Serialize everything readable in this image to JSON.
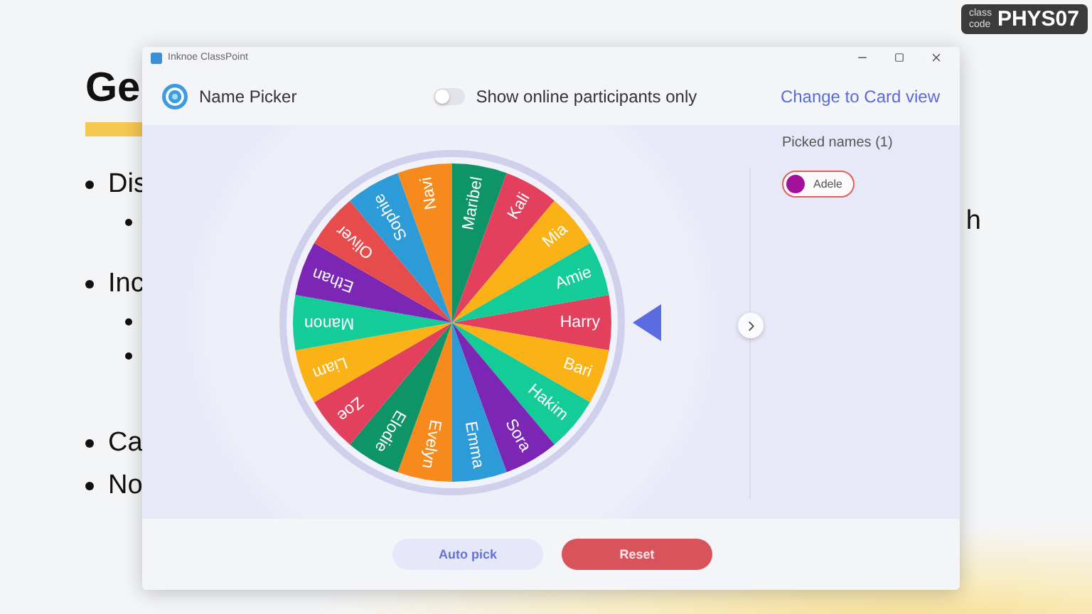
{
  "class_code": {
    "label_top": "class",
    "label_bottom": "code",
    "code": "PHYS07"
  },
  "slide": {
    "title": "Ge",
    "bullets": [
      {
        "text": "Dis",
        "children": [
          {
            "kind": "covered",
            "tail": "h"
          }
        ]
      },
      {
        "text": "Inc",
        "children": [
          {
            "kind": "covered"
          },
          {
            "kind": "covered"
          }
        ]
      },
      {
        "text": "Ca"
      },
      {
        "text": "No"
      }
    ]
  },
  "window": {
    "title": "Inknoe ClassPoint"
  },
  "header": {
    "title": "Name Picker",
    "online_toggle": {
      "label": "Show online participants only",
      "on": false
    },
    "card_view_link": "Change to Card view"
  },
  "wheel": {
    "segments": [
      {
        "name": "Harry",
        "color": "#e2405c"
      },
      {
        "name": "Bari",
        "color": "#fbb216"
      },
      {
        "name": "Hakim",
        "color": "#13cc98"
      },
      {
        "name": "Sora",
        "color": "#7b26b5"
      },
      {
        "name": "Emma",
        "color": "#2d9bd8"
      },
      {
        "name": "Evelyn",
        "color": "#f78a1c"
      },
      {
        "name": "Elodie",
        "color": "#0e9467"
      },
      {
        "name": "Zoe",
        "color": "#e2405c"
      },
      {
        "name": "Liam",
        "color": "#fbb216"
      },
      {
        "name": "Manon",
        "color": "#13cc98"
      },
      {
        "name": "Ethan",
        "color": "#7b26b5"
      },
      {
        "name": "Oliver",
        "color": "#e74c4c"
      },
      {
        "name": "Sophie",
        "color": "#2d9bd8"
      },
      {
        "name": "Navi",
        "color": "#f78a1c"
      },
      {
        "name": "Maribel",
        "color": "#0e9467"
      },
      {
        "name": "Kali",
        "color": "#e2405c"
      },
      {
        "name": "Mia",
        "color": "#fbb216"
      },
      {
        "name": "Amie",
        "color": "#13cc98"
      }
    ]
  },
  "picked": {
    "title": "Picked names (1)",
    "names": [
      {
        "name": "Adele"
      }
    ]
  },
  "buttons": [
    {
      "label": "Auto pick",
      "kind": "secondary"
    },
    {
      "label": "Reset",
      "kind": "danger"
    }
  ]
}
